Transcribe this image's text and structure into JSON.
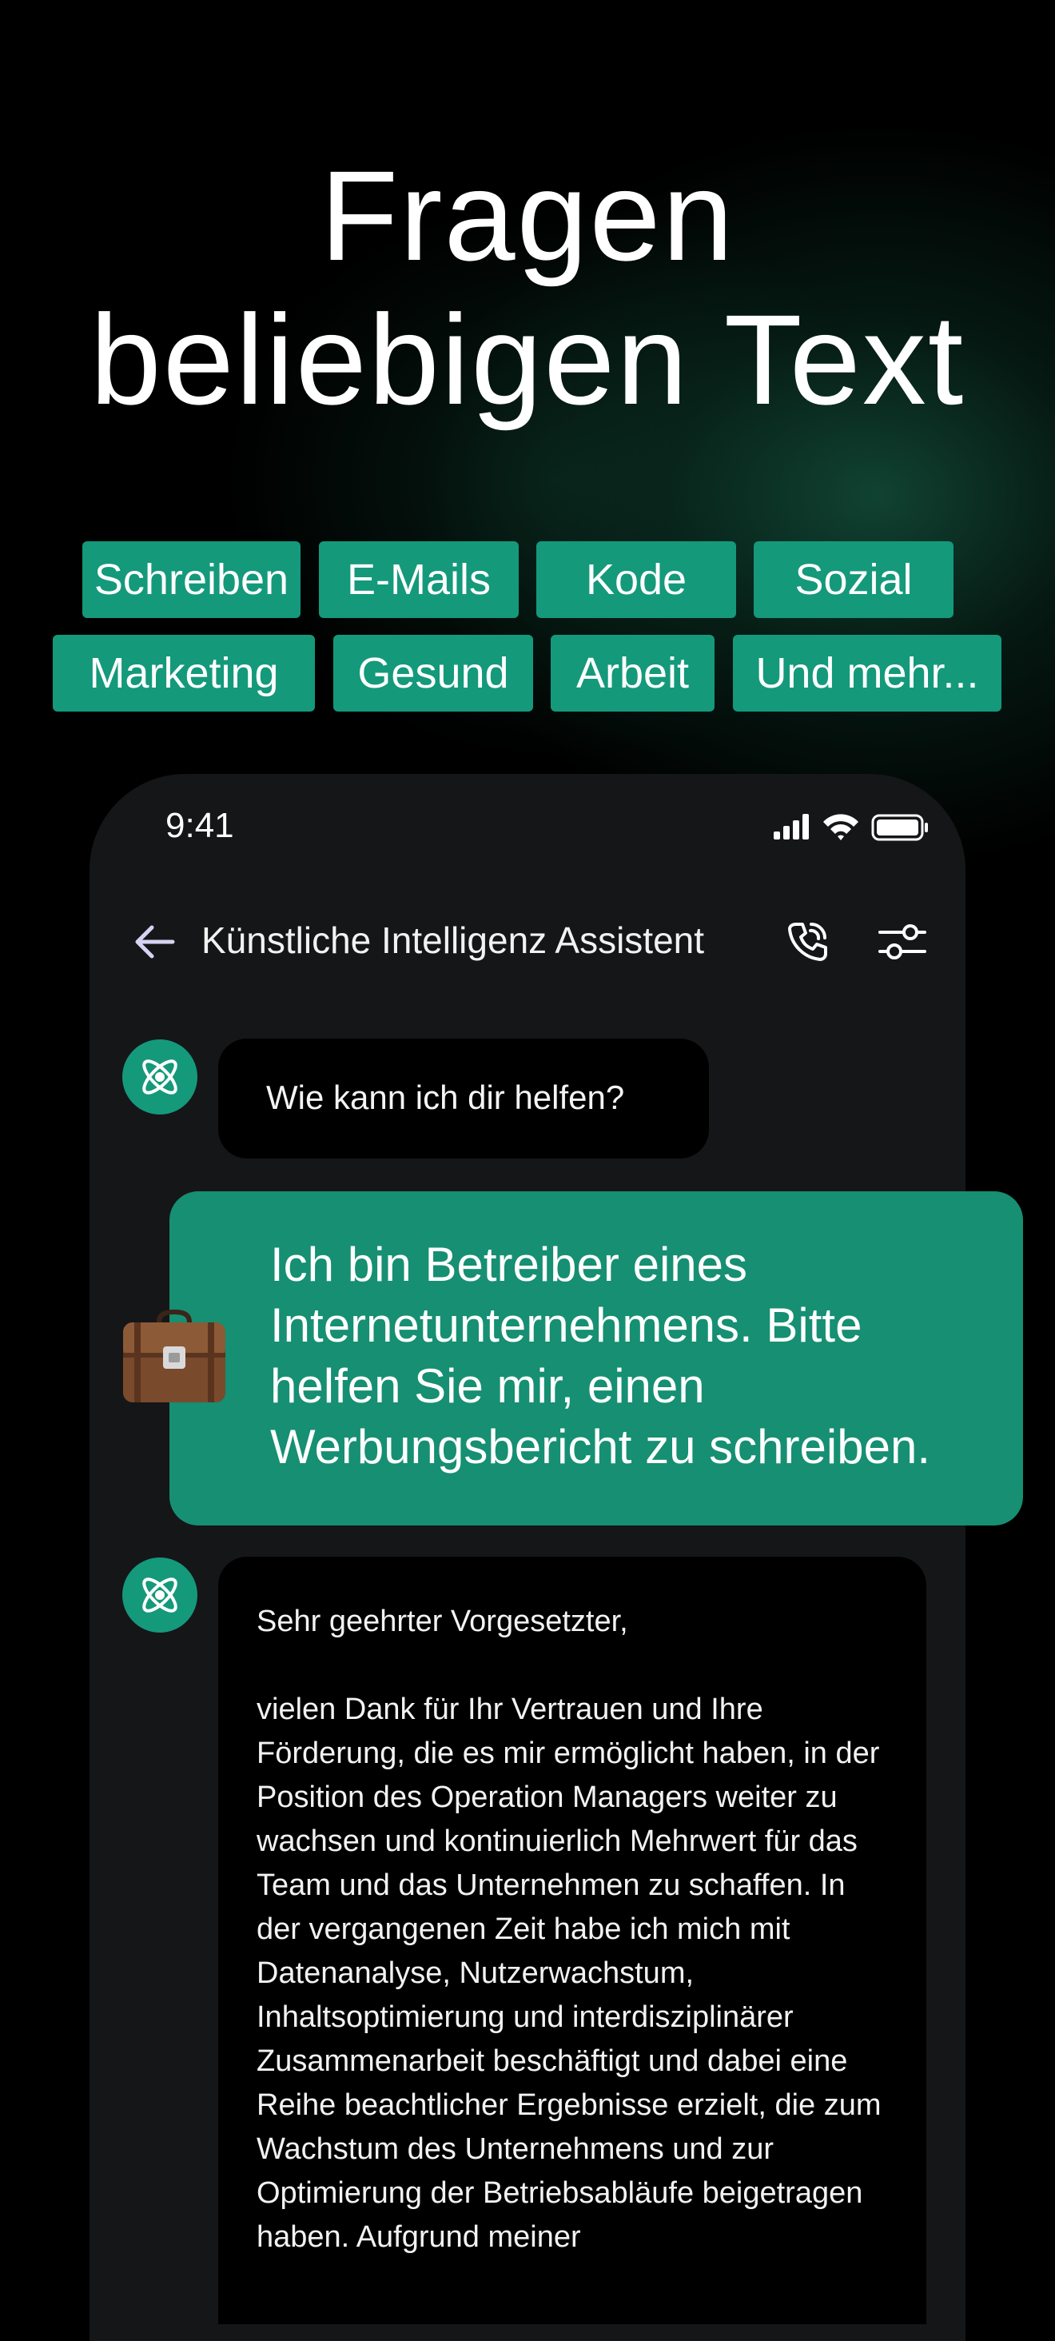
{
  "hero": {
    "title_line1": "Fragen",
    "title_line2": "beliebigen Text"
  },
  "chips": [
    {
      "label": "Schreiben"
    },
    {
      "label": "E-Mails"
    },
    {
      "label": "Kode"
    },
    {
      "label": "Sozial"
    },
    {
      "label": "Marketing"
    },
    {
      "label": "Gesund"
    },
    {
      "label": "Arbeit"
    },
    {
      "label": "Und mehr..."
    }
  ],
  "status_bar": {
    "time": "9:41",
    "icons": [
      "cellular-signal-icon",
      "wifi-icon",
      "battery-icon"
    ]
  },
  "nav": {
    "title": "Künstliche Intelligenz Assistent",
    "icons": [
      "back-arrow-icon",
      "phone-call-icon",
      "sliders-icon"
    ]
  },
  "chat": {
    "bot_greeting": "Wie kann ich dir helfen?",
    "user_message": "Ich bin Betreiber eines Internetunternehmens. Bitte helfen Sie mir, einen Werbungsbericht zu schreiben.",
    "bot_reply_salutation": "Sehr geehrter Vorgesetzter,",
    "bot_reply_body": "vielen Dank für Ihr Vertrauen und Ihre Förderung, die es mir ermöglicht haben, in der Position des Operation Managers weiter zu wachsen und kontinuierlich Mehrwert für das Team und das Unternehmen zu schaffen. In der vergangenen Zeit habe ich mich mit Datenanalyse, Nutzerwachstum, Inhaltsoptimierung und interdisziplinärer Zusammenarbeit beschäftigt und dabei eine Reihe beachtlicher Ergebnisse erzielt, die zum Wachstum des Unternehmens und zur Optimierung der Betriebsabläufe beigetragen haben. Aufgrund meiner"
  },
  "colors": {
    "accent": "#14997b",
    "user_bubble": "#168f72",
    "phone_background": "#151618",
    "page_background": "#000000"
  }
}
